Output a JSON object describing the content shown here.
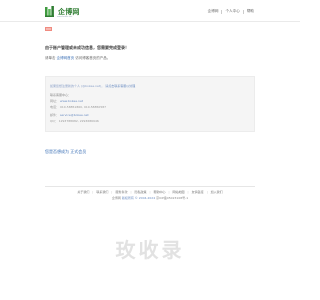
{
  "header": {
    "logo_text": "企博网",
    "logo_sub": "www.bokee.net",
    "nav": [
      "企博网",
      "个人中心",
      "帮助"
    ]
  },
  "message": {
    "title": "由于账户管理或未成功信息，您需要完成登录！",
    "line_prefix": "请单击",
    "line_link": "企博网首页",
    "line_suffix": "访问博客首页的产品。"
  },
  "info_box": {
    "first_prefix": "如果您想注册新的个人 (@bokee.net)，",
    "first_link": "请点击联系客服以处理",
    "row1": "联系客服中心：",
    "row2_label": "网址：",
    "row2_value": "www.bokee.net",
    "row3_label": "电话：",
    "row3_value": "010-58851860, 010-58850587",
    "row4_label": "邮件：",
    "row4_value": "service@bokee.net",
    "row5_label": "QQ：",
    "row5_value": "1293788682, 2293686946"
  },
  "register_title": "您是否想成为 正式会员",
  "footer": {
    "links": [
      "关于我们",
      "联系我们",
      "服务条款",
      "隐私政策",
      "帮助中心",
      "网站地图",
      "友情链接",
      "加入我们"
    ],
    "copy_brand": "企博网",
    "copy_text": "版权所有 © 2004-2024",
    "copy_icp": "京ICP备05023108号-1"
  },
  "watermark": "玫收录",
  "colors": {
    "brand_green": "#2f7d32",
    "link_blue": "#3a6fb5",
    "box_bg": "#f5f5f5",
    "alert_red": "#f08b80"
  }
}
